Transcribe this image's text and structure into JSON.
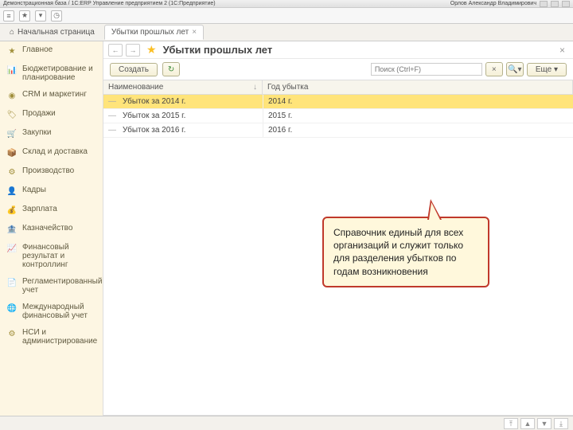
{
  "window": {
    "title_left": "Демонстрационная база / 1С:ERP Управление предприятием 2 (1С:Предприятие)",
    "title_right": "Орлов Александр Владимирович"
  },
  "tabs": {
    "home": "Начальная страница",
    "active": "Убытки прошлых лет"
  },
  "sidebar": {
    "items": [
      {
        "label": "Главное"
      },
      {
        "label": "Бюджетирование и планирование"
      },
      {
        "label": "CRM и маркетинг"
      },
      {
        "label": "Продажи"
      },
      {
        "label": "Закупки"
      },
      {
        "label": "Склад и доставка"
      },
      {
        "label": "Производство"
      },
      {
        "label": "Кадры"
      },
      {
        "label": "Зарплата"
      },
      {
        "label": "Казначейство"
      },
      {
        "label": "Финансовый результат и контроллинг"
      },
      {
        "label": "Регламентированный учет"
      },
      {
        "label": "Международный финансовый учет"
      },
      {
        "label": "НСИ и администрирование"
      }
    ]
  },
  "page": {
    "title": "Убытки прошлых лет",
    "create": "Создать",
    "search_placeholder": "Поиск (Ctrl+F)",
    "more": "Еще",
    "col_name": "Наименование",
    "col_year": "Год убытка",
    "rows": [
      {
        "name": "Убыток за 2014 г.",
        "year": "2014 г."
      },
      {
        "name": "Убыток за 2015 г.",
        "year": "2015 г."
      },
      {
        "name": "Убыток за 2016 г.",
        "year": "2016 г."
      }
    ]
  },
  "callout": {
    "text": "Справочник единый для всех организаций и служит только для разделения убытков по годам возникновения"
  }
}
